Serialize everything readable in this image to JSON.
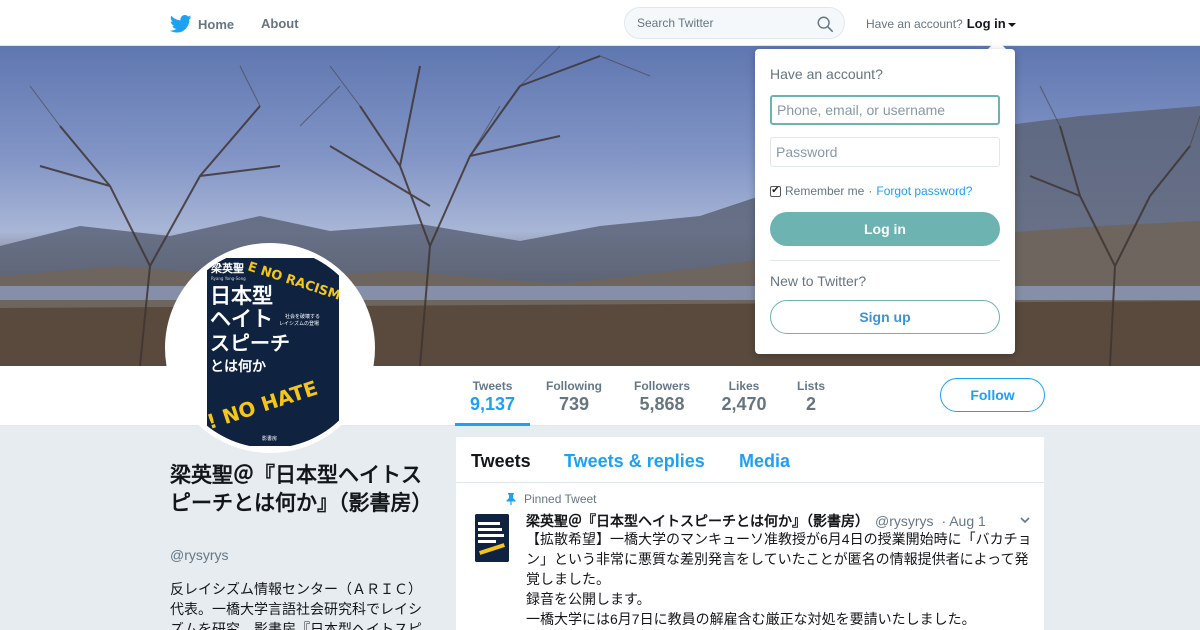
{
  "topbar": {
    "home_label": "Home",
    "about_label": "About",
    "search_placeholder": "Search Twitter",
    "have_account": "Have an account?",
    "login_label": "Log in"
  },
  "profile_nav": {
    "stats": [
      {
        "label": "Tweets",
        "value": "9,137"
      },
      {
        "label": "Following",
        "value": "739"
      },
      {
        "label": "Followers",
        "value": "5,868"
      },
      {
        "label": "Likes",
        "value": "2,470"
      },
      {
        "label": "Lists",
        "value": "2"
      }
    ],
    "follow_label": "Follow"
  },
  "avatar": {
    "book_author": "梁英聖",
    "book_author_romaji": "Ryang Yong-Song",
    "book_title_lines": [
      "日本型",
      "ヘイト",
      "スピーチ",
      "とは何か"
    ],
    "book_subtitle_lines": [
      "社会を破壊する",
      "レイシズムの登場"
    ],
    "sticker_top": "E NO RACISM",
    "sticker_bottom": "! NO HATE",
    "publisher": "影書房"
  },
  "profile": {
    "name": "梁英聖＠『日本型ヘイトスピーチとは何か』（影書房）",
    "handle": "@rysyrys",
    "bio": "反レイシズム情報センター（ＡＲＩＣ）代表。一橋大学言語社会研究科でレイシズムを研究。影書房『日本型ヘイトスピ"
  },
  "timeline": {
    "tabs": [
      "Tweets",
      "Tweets & replies",
      "Media"
    ],
    "pinned_label": "Pinned Tweet",
    "tweet": {
      "author": "梁英聖＠『日本型ヘイトスピーチとは何か』（影書房）",
      "handle": "@rysyrys",
      "date": "· Aug 1",
      "lines": [
        "【拡散希望】一橋大学のマンキューソ准教授が6月4日の授業開始時に「バカチョン」という非常に悪質な差別発言をしていたことが匿名の情報提供者によって発覚しました。",
        "録音を公開します。",
        "一橋大学には6月7日に教員の解雇含む厳正な対処を要請いたしました。"
      ]
    }
  },
  "login_dropdown": {
    "title": "Have an account?",
    "username_placeholder": "Phone, email, or username",
    "password_placeholder": "Password",
    "remember_label": "Remember me",
    "separator": "·",
    "forgot_label": "Forgot password?",
    "login_button": "Log in",
    "new_label": "New to Twitter?",
    "signup_button": "Sign up"
  },
  "colors": {
    "twitter_blue": "#1da1f2",
    "teal_accent": "#6cb3b2",
    "book_navy": "#0f2341",
    "sticker_yellow": "#f5c518"
  },
  "icons": [
    "twitter-bird-icon",
    "search-icon",
    "caret-down-icon",
    "pin-icon",
    "chevron-down-icon",
    "checkbox-checked-icon"
  ]
}
